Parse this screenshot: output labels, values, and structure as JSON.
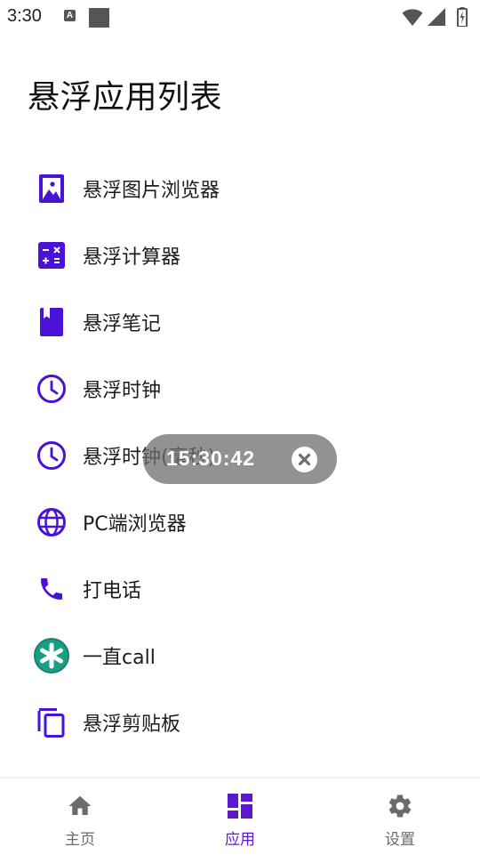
{
  "status_bar": {
    "time": "3:30",
    "left_icons": [
      "a-notification-icon",
      "square-notification-icon"
    ],
    "right_icons": [
      "wifi-icon",
      "signal-icon",
      "battery-charging-icon"
    ]
  },
  "page": {
    "title": "悬浮应用列表"
  },
  "colors": {
    "accent": "#4a11d6",
    "text": "#1c1c1c",
    "nav_inactive": "#6b6b6b",
    "nav_active": "#5b18cf"
  },
  "app_list": [
    {
      "label": "悬浮图片浏览器",
      "icon": "image-icon"
    },
    {
      "label": "悬浮计算器",
      "icon": "calculator-icon"
    },
    {
      "label": "悬浮笔记",
      "icon": "bookmark-book-icon"
    },
    {
      "label": "悬浮时钟",
      "icon": "clock-icon"
    },
    {
      "label": "悬浮时钟(毫秒)",
      "icon": "clock-icon"
    },
    {
      "label": "PC端浏览器",
      "icon": "globe-icon"
    },
    {
      "label": "打电话",
      "icon": "phone-icon"
    },
    {
      "label": "一直call",
      "icon": "call-app-logo-icon"
    },
    {
      "label": "悬浮剪贴板",
      "icon": "copy-icon"
    }
  ],
  "floating_clock": {
    "time": "15:30:42",
    "close_icon": "close-circle-icon"
  },
  "bottom_nav": [
    {
      "label": "主页",
      "icon": "home-icon",
      "active": false
    },
    {
      "label": "应用",
      "icon": "dashboard-icon",
      "active": true
    },
    {
      "label": "设置",
      "icon": "gear-icon",
      "active": false
    }
  ]
}
